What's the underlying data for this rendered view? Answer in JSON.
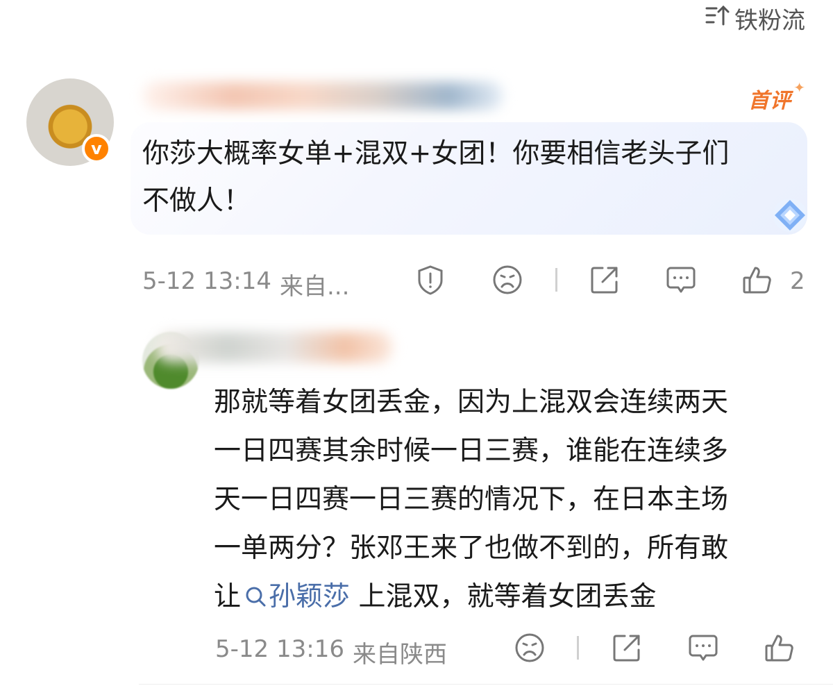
{
  "sort": {
    "icon": "sort-icon",
    "label": "铁粉流"
  },
  "comment": {
    "badge": "首评",
    "text_line1": "你莎大概率女单+混双+女团！你要相信老头子们",
    "text_line2": "不做人！",
    "time": "5-12 13:14",
    "location": "来自...",
    "like_count": "2",
    "icons": [
      "report-icon",
      "dislike-icon",
      "share-icon",
      "comment-icon",
      "like-icon"
    ],
    "verified": "v"
  },
  "reply": {
    "lines": [
      "那就等着女团丢金，因为上混双会连续两天",
      "一日四赛其余时候一日三赛，谁能在连续多",
      "天一日四赛一日三赛的情况下，在日本主场",
      "一单两分？张邓王来了也做不到的，所有敢"
    ],
    "line5_prefix": "让",
    "topic_link": "孙颖莎",
    "line5_suffix": "上混双，就等着女团丢金",
    "time": "5-12 13:16",
    "location": "来自陕西",
    "icons": [
      "dislike-icon",
      "share-icon",
      "comment-icon",
      "like-icon"
    ]
  },
  "colors": {
    "accent_orange": "#f0752b",
    "link_blue": "#4a6ea9",
    "meta_gray": "#8a8a8a"
  }
}
